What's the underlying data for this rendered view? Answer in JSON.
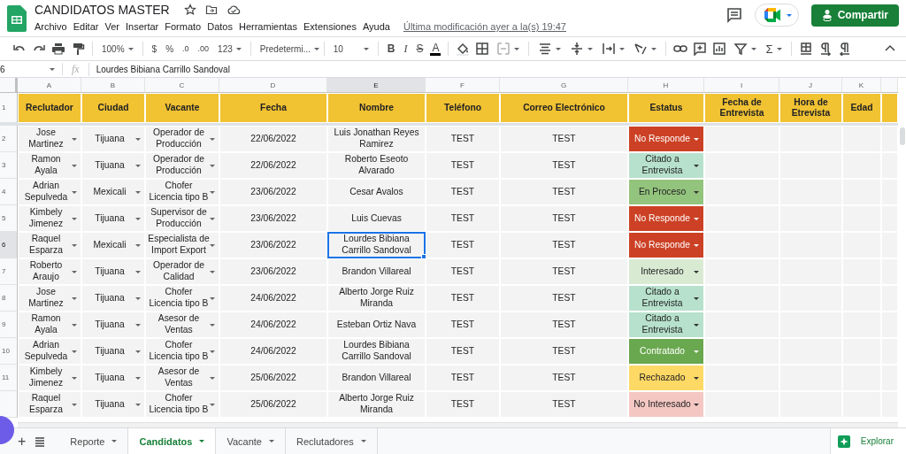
{
  "app": {
    "title": "CANDIDATOS MASTER",
    "menu": [
      "Archivo",
      "Editar",
      "Ver",
      "Insertar",
      "Formato",
      "Datos",
      "Herramientas",
      "Extensiones",
      "Ayuda"
    ],
    "last_edit": "Última modificación ayer a la(s) 19:47",
    "share_button": "Compartir"
  },
  "toolbar": {
    "zoom": "100%",
    "currency": "$",
    "percent": "%",
    "decimal_less": ".0",
    "decimal_more": ".00",
    "number_format": "123",
    "font": "Predetermi...",
    "font_size": "10",
    "bold": "B",
    "italic": "I",
    "strike": "S",
    "text_color": "A",
    "functions": "Σ"
  },
  "formula_bar": {
    "cell_ref": "6",
    "function_label": "fx",
    "value": "Lourdes Bibiana Carrillo Sandoval"
  },
  "sheet": {
    "column_letters": [
      {
        "label": "A",
        "selected": false
      },
      {
        "label": "B",
        "selected": false
      },
      {
        "label": "C",
        "selected": false
      },
      {
        "label": "D",
        "selected": false
      },
      {
        "label": "E",
        "selected": true
      },
      {
        "label": "F",
        "selected": false
      },
      {
        "label": "G",
        "selected": false
      },
      {
        "label": "H",
        "selected": false
      },
      {
        "label": "I",
        "selected": false
      },
      {
        "label": "J",
        "selected": false
      },
      {
        "label": "K",
        "selected": false
      }
    ],
    "header_row_number": "1",
    "header": [
      "Reclutador",
      "Ciudad",
      "Vacante",
      "Fecha",
      "Nombre",
      "Teléfono",
      "Correo Electrónico",
      "Estatus",
      "Fecha de Entrevista",
      "Hora de Etrevista",
      "Edad"
    ],
    "rows": [
      {
        "number": "2",
        "selected": false,
        "reclutador": "Jose Martinez",
        "ciudad": "Tijuana",
        "vacante": "Operador de Producción",
        "fecha": "22/06/2022",
        "nombre": "Luis Jonathan Reyes Ramirez",
        "telefono": "TEST",
        "correo": "TEST",
        "status": {
          "label": "No Responde",
          "color": "#cc4125"
        }
      },
      {
        "number": "3",
        "selected": false,
        "reclutador": "Ramon Ayala",
        "ciudad": "Tijuana",
        "vacante": "Operador de Producción",
        "fecha": "22/06/2022",
        "nombre": "Roberto Eseoto Alvarado",
        "telefono": "TEST",
        "correo": "TEST",
        "status": {
          "label": "Citado a Entrevista",
          "color": "#b7e1cd"
        }
      },
      {
        "number": "4",
        "selected": false,
        "reclutador": "Adrian Sepulveda",
        "ciudad": "Mexicali",
        "vacante": "Chofer Licencia tipo B",
        "fecha": "23/06/2022",
        "nombre": "Cesar Avalos",
        "telefono": "TEST",
        "correo": "TEST",
        "status": {
          "label": "En Proceso",
          "color": "#93c47d"
        }
      },
      {
        "number": "5",
        "selected": false,
        "reclutador": "Kimbely Jimenez",
        "ciudad": "Tijuana",
        "vacante": "Supervisor de Producción",
        "fecha": "23/06/2022",
        "nombre": "Luis Cuevas",
        "telefono": "TEST",
        "correo": "TEST",
        "status": {
          "label": "No Responde",
          "color": "#cc4125"
        }
      },
      {
        "number": "6",
        "selected": true,
        "reclutador": "Raquel Esparza",
        "ciudad": "Mexicali",
        "vacante": "Especialista de Import Export",
        "fecha": "23/06/2022",
        "nombre": "Lourdes Bibiana Carrillo Sandoval",
        "telefono": "TEST",
        "correo": "TEST",
        "status": {
          "label": "No Responde",
          "color": "#cc4125"
        }
      },
      {
        "number": "7",
        "selected": false,
        "reclutador": "Roberto Araujo",
        "ciudad": "Tijuana",
        "vacante": "Operador de Calidad",
        "fecha": "23/06/2022",
        "nombre": "Brandon Villareal",
        "telefono": "TEST",
        "correo": "TEST",
        "status": {
          "label": "Interesado",
          "color": "#d9ead3"
        }
      },
      {
        "number": "8",
        "selected": false,
        "reclutador": "Jose Martinez",
        "ciudad": "Tijuana",
        "vacante": "Chofer Licencia tipo B",
        "fecha": "24/06/2022",
        "nombre": "Alberto Jorge Ruiz Miranda",
        "telefono": "TEST",
        "correo": "TEST",
        "status": {
          "label": "Citado a Entrevista",
          "color": "#b7e1cd"
        }
      },
      {
        "number": "9",
        "selected": false,
        "reclutador": "Ramon Ayala",
        "ciudad": "Tijuana",
        "vacante": "Asesor de Ventas",
        "fecha": "24/06/2022",
        "nombre": "Esteban Ortiz Nava",
        "telefono": "TEST",
        "correo": "TEST",
        "status": {
          "label": "Citado a Entrevista",
          "color": "#b7e1cd"
        }
      },
      {
        "number": "10",
        "selected": false,
        "reclutador": "Adrian Sepulveda",
        "ciudad": "Tijuana",
        "vacante": "Chofer Licencia tipo B",
        "fecha": "24/06/2022",
        "nombre": "Lourdes Bibiana Carrillo Sandoval",
        "telefono": "TEST",
        "correo": "TEST",
        "status": {
          "label": "Contratado",
          "color": "#6aa84f"
        }
      },
      {
        "number": "11",
        "selected": false,
        "reclutador": "Kimbely Jimenez",
        "ciudad": "Tijuana",
        "vacante": "Asesor de Ventas",
        "fecha": "25/06/2022",
        "nombre": "Brandon Villareal",
        "telefono": "TEST",
        "correo": "TEST",
        "status": {
          "label": "Rechazado",
          "color": "#ffd966"
        }
      },
      {
        "selected": false,
        "reclutador": "Raquel Esparza",
        "ciudad": "Tijuana",
        "vacante": "Chofer Licencia tipo B",
        "fecha": "25/06/2022",
        "nombre": "Alberto Jorge Ruiz Miranda",
        "telefono": "TEST",
        "correo": "TEST",
        "status": {
          "label": "No Interesado",
          "color": "#f4c7c3"
        }
      }
    ]
  },
  "sheet_tabs": [
    {
      "label": "Reporte",
      "selected": false
    },
    {
      "label": "Candidatos",
      "selected": true
    },
    {
      "label": "Vacante",
      "selected": false
    },
    {
      "label": "Reclutadores",
      "selected": false
    }
  ],
  "add_sheet": "+",
  "explore_button": "Explorar"
}
